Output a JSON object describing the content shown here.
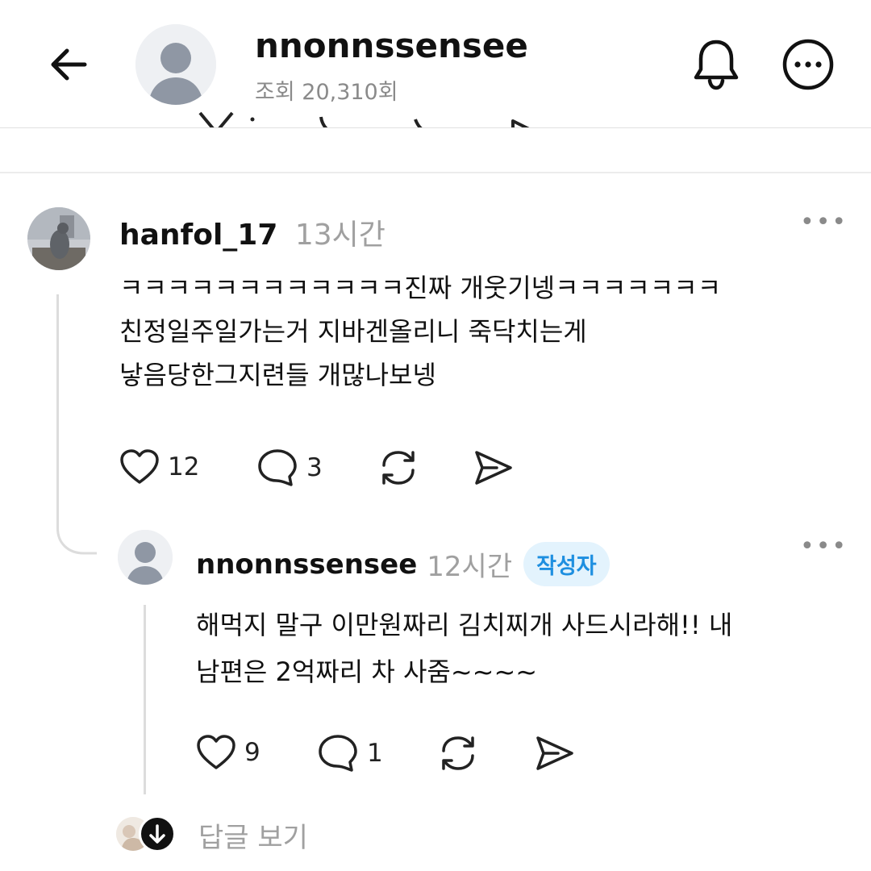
{
  "header": {
    "back_icon": "arrow-left-icon",
    "username": "nnonnssensee",
    "views": "조회 20,310회",
    "bell_icon": "bell-icon",
    "more_icon": "more-circle-icon"
  },
  "comment": {
    "username": "hanfol_17",
    "time": "13시간",
    "lines": [
      "ㅋㅋㅋㅋㅋㅋㅋㅋㅋㅋㅋㅋ진짜 개웃기넹ㅋㅋㅋㅋㅋㅋㅋ",
      "친정일주일가는거 지바겐올리니 죽닥치는게",
      "낳음당한그지련들 개많나보넹"
    ],
    "like_count": "12",
    "reply_count": "3"
  },
  "reply": {
    "username": "nnonnssensee",
    "time": "12시간",
    "author_badge": "작성자",
    "lines": [
      "해먹지 말구 이만원짜리 김치찌개 사드시라해!! 내",
      "남편은 2억짜리 차 사줌~~~~"
    ],
    "like_count": "9",
    "reply_count": "1"
  },
  "footer": {
    "view_replies_label": "답글 보기"
  },
  "colors": {
    "badge_bg": "#e3f3fd",
    "badge_text": "#1e8fe0",
    "muted": "#a0a0a0"
  }
}
